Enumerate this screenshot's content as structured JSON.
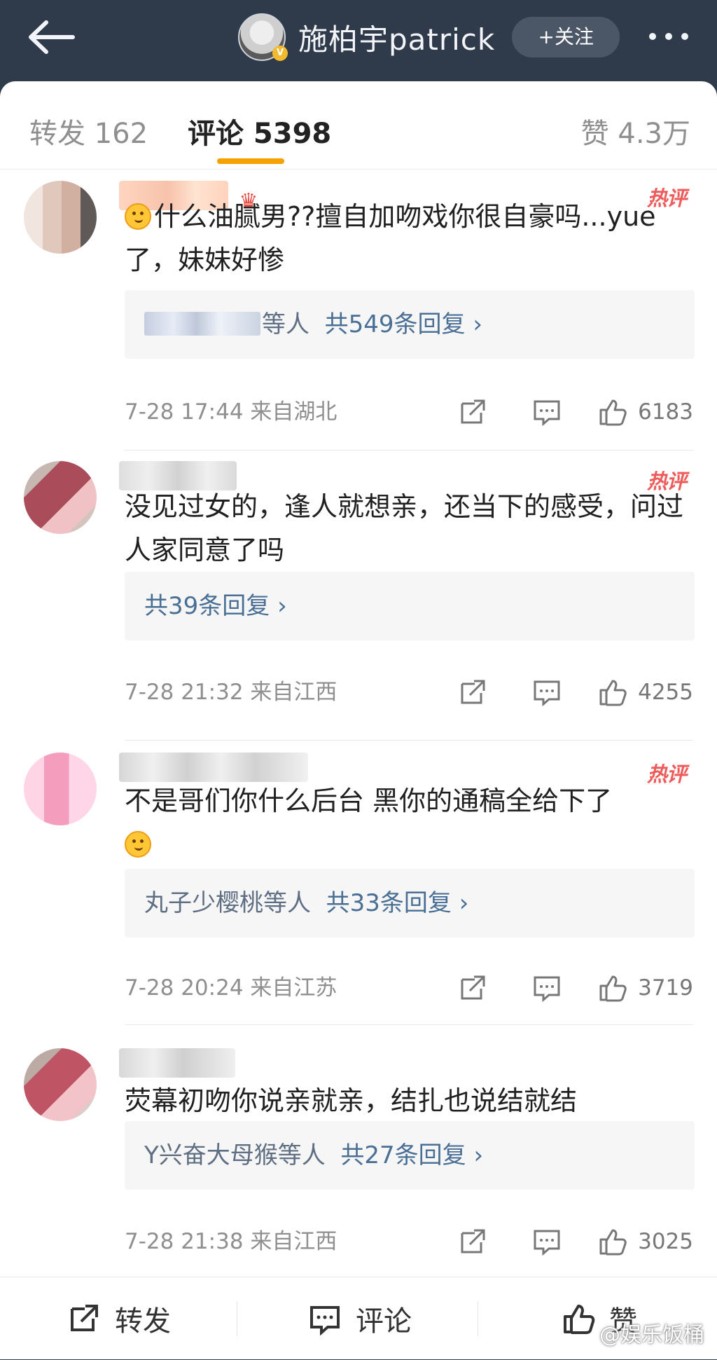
{
  "header": {
    "user_name": "施柏宇patrick",
    "follow_label": "+关注"
  },
  "tabs": {
    "reposts": "转发 162",
    "comments": "评论 5398",
    "likes": "赞 4.3万"
  },
  "comments": [
    {
      "hot_label": "热评",
      "text": "什么油腻男??擅自加吻戏你很自豪吗...yue了，妹妹好惨",
      "reply_suffix": "等人",
      "reply_count": "共549条回复 ›",
      "time_location": "7-28 17:44  来自湖北",
      "likes": "6183"
    },
    {
      "hot_label": "热评",
      "text": "没见过女的，逢人就想亲，还当下的感受，问过人家同意了吗",
      "reply_count": "共39条回复 ›",
      "time_location": "7-28 21:32  来自江西",
      "likes": "4255"
    },
    {
      "hot_label": "热评",
      "text": "不是哥们你什么后台 黑你的通稿全给下了",
      "reply_name": "丸子少樱桃",
      "reply_suffix": "等人",
      "reply_count": "共33条回复 ›",
      "time_location": "7-28 20:24  来自江苏",
      "likes": "3719"
    },
    {
      "text": "荧幕初吻你说亲就亲，结扎也说结就结",
      "reply_name": "Y兴奋大母猴",
      "reply_suffix": "等人",
      "reply_count": "共27条回复 ›",
      "time_location": "7-28 21:38  来自江西",
      "likes": "3025"
    }
  ],
  "bottom_bar": {
    "repost": "转发",
    "comment": "评论",
    "like": "赞"
  },
  "watermark": "@娱乐饭桶"
}
